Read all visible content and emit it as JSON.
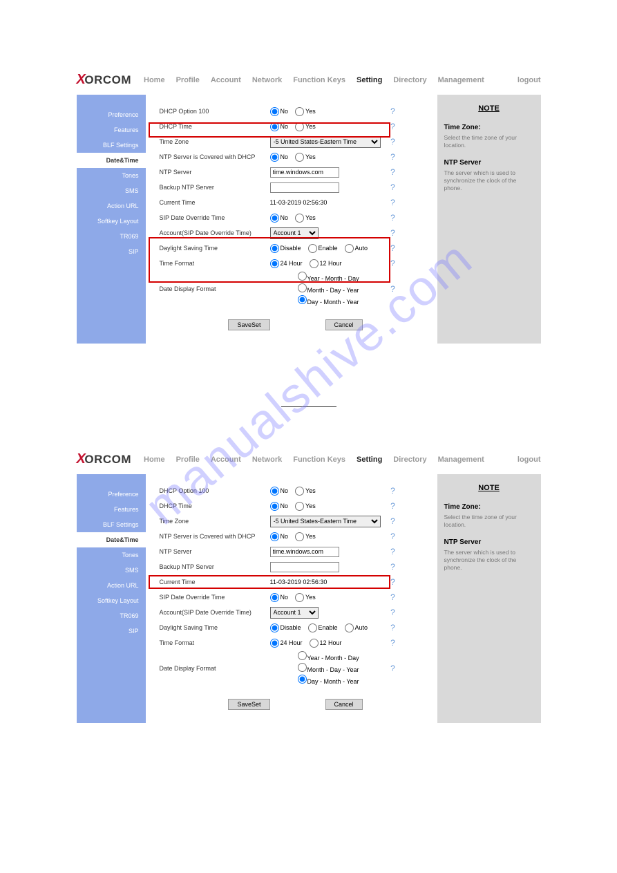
{
  "watermark": "manualshive.com",
  "brand": "ORCOM",
  "nav": [
    "Home",
    "Profile",
    "Account",
    "Network",
    "Function Keys",
    "Setting",
    "Directory",
    "Management"
  ],
  "nav_active": "Setting",
  "logout": "logout",
  "sidebar": [
    "Preference",
    "Features",
    "BLF Settings",
    "Date&Time",
    "Tones",
    "SMS",
    "Action URL",
    "Softkey Layout",
    "TR069",
    "SIP"
  ],
  "sidebar_active": "Date&Time",
  "rows": {
    "dhcp100": "DHCP Option 100",
    "dhcptime": "DHCP Time",
    "timezone": "Time Zone",
    "timezone_val": "-5 United States-Eastern Time",
    "ntpcov": "NTP Server is Covered with DHCP",
    "ntpserver": "NTP Server",
    "ntpserver_val": "time.windows.com",
    "backupntp": "Backup NTP Server",
    "current": "Current Time",
    "current_val": "11-03-2019 02:56:30",
    "sipov": "SIP Date Override Time",
    "account": "Account(SIP Date Override Time)",
    "account_val": "Account 1",
    "dst": "Daylight Saving Time",
    "timefmt": "Time Format",
    "datefmt": "Date Display Format",
    "opt_no": "No",
    "opt_yes": "Yes",
    "opt_disable": "Disable",
    "opt_enable": "Enable",
    "opt_auto": "Auto",
    "opt_24h": "24 Hour",
    "opt_12h": "12 Hour",
    "opt_ymd": "Year - Month - Day",
    "opt_mdy": "Month - Day - Year",
    "opt_dmy": "Day - Month - Year"
  },
  "btn_save": "SaveSet",
  "btn_cancel": "Cancel",
  "note": {
    "title": "NOTE",
    "tz_h": "Time Zone:",
    "tz_b": "Select the time zone of your location.",
    "ntp_h": "NTP Server",
    "ntp_b": "The server which is used to synchronize the clock of the phone."
  },
  "panel1_highlight": "timezone",
  "panel2_highlight": "sipov"
}
